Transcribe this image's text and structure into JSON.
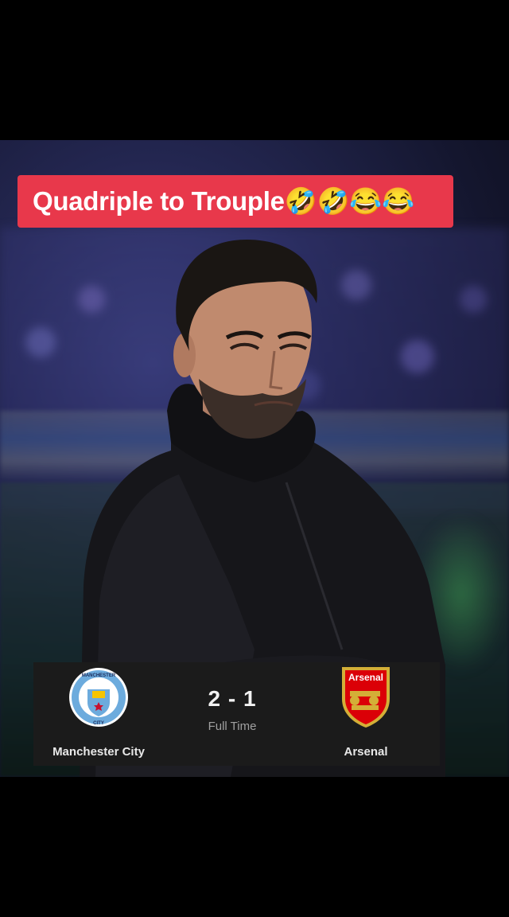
{
  "caption": {
    "text": "Quadriple to Trouple🤣🤣😂😂",
    "background": "#e8384b"
  },
  "match": {
    "home_team": "Manchester City",
    "away_team": "Arsenal",
    "score": "2 - 1",
    "status": "Full Time",
    "home_crest_icon": "manchester-city-crest",
    "away_crest_icon": "arsenal-crest",
    "home_crest_text": "MANCHESTER CITY",
    "away_crest_text": "Arsenal"
  }
}
